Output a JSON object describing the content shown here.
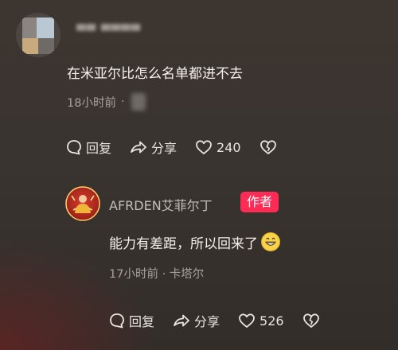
{
  "comment": {
    "username": "▀▀ ▀▀▀▀",
    "text": "在米亚尔比怎么名单都进不去",
    "time": "18小时前",
    "separator": "·",
    "actions": {
      "reply_label": "回复",
      "share_label": "分享",
      "like_count": "240"
    }
  },
  "reply": {
    "username": "AFRDEN艾菲尔丁",
    "badge": "作者",
    "text": "能力有差距，所以回来了",
    "emoji": "grinning-face-emoji",
    "time": "17小时前",
    "separator": "·",
    "location": "卡塔尔",
    "actions": {
      "reply_label": "回复",
      "share_label": "分享",
      "like_count": "526"
    }
  },
  "colors": {
    "background": "#3a3430",
    "primary_text": "#f4f1ec",
    "secondary_text": "#a9a29c",
    "author_badge": "#fe2c55"
  },
  "icons": {
    "reply": "comment-bubble-icon",
    "share": "share-arrow-icon",
    "like": "heart-icon",
    "dislike": "broken-heart-icon"
  }
}
